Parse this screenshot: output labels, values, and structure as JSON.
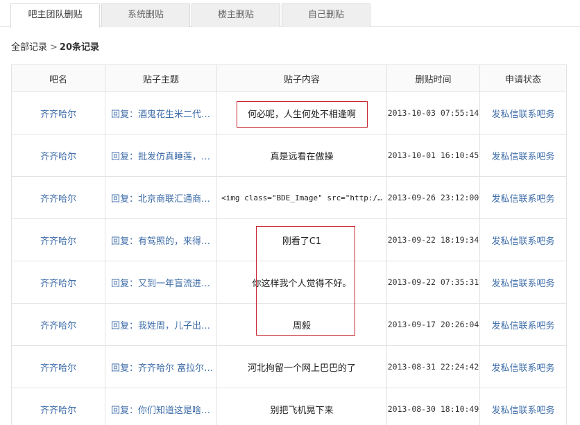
{
  "tabs": [
    {
      "label": "吧主团队删贴",
      "active": true
    },
    {
      "label": "系统删贴",
      "active": false
    },
    {
      "label": "楼主删贴",
      "active": false
    },
    {
      "label": "自己删贴",
      "active": false
    }
  ],
  "breadcrumb": {
    "all": "全部记录",
    "sep": ">",
    "count": "20条记录"
  },
  "table": {
    "headers": [
      "吧名",
      "贴子主题",
      "贴子内容",
      "删贴时间",
      "申请状态"
    ],
    "rows": [
      {
        "forum": "齐齐哈尔",
        "topic": "回复：酒鬼花生米二代，…",
        "content": "何必呢，人生何处不相逢啊",
        "time": "2013-10-03 07:55:14",
        "status": "发私信联系吧务"
      },
      {
        "forum": "齐齐哈尔",
        "topic": "回复：批发仿真睡莲，鸳…",
        "content": "真是远看在做操",
        "time": "2013-10-01 16:10:45",
        "status": "发私信联系吧务"
      },
      {
        "forum": "齐齐哈尔",
        "topic": "回复：北京商联汇通商贸…",
        "content": "<img class=\"BDE_Image\" src=\"http://im…",
        "time": "2013-09-26 23:12:00",
        "status": "发私信联系吧务"
      },
      {
        "forum": "齐齐哈尔",
        "topic": "回复：有驾照的，来得瑟…",
        "content": "刚看了C1",
        "time": "2013-09-22 18:19:34",
        "status": "发私信联系吧务"
      },
      {
        "forum": "齐齐哈尔",
        "topic": "回复：又到一年盲流进城季",
        "content": "你这样我个人觉得不好。",
        "time": "2013-09-22 07:35:31",
        "status": "发私信联系吧务"
      },
      {
        "forum": "齐齐哈尔",
        "topic": "回复：我姓周，儿子出生…",
        "content": "周毅",
        "time": "2013-09-17 20:26:04",
        "status": "发私信联系吧务"
      },
      {
        "forum": "齐齐哈尔",
        "topic": "回复：齐齐哈尔 富拉尔基…",
        "content": "河北拘留一个网上巴巴的了",
        "time": "2013-08-31 22:24:42",
        "status": "发私信联系吧务"
      },
      {
        "forum": "齐齐哈尔",
        "topic": "回复：你们知道这是啥不…",
        "content": "别把飞机晃下来",
        "time": "2013-08-30 18:10:49",
        "status": "发私信联系吧务"
      }
    ]
  }
}
